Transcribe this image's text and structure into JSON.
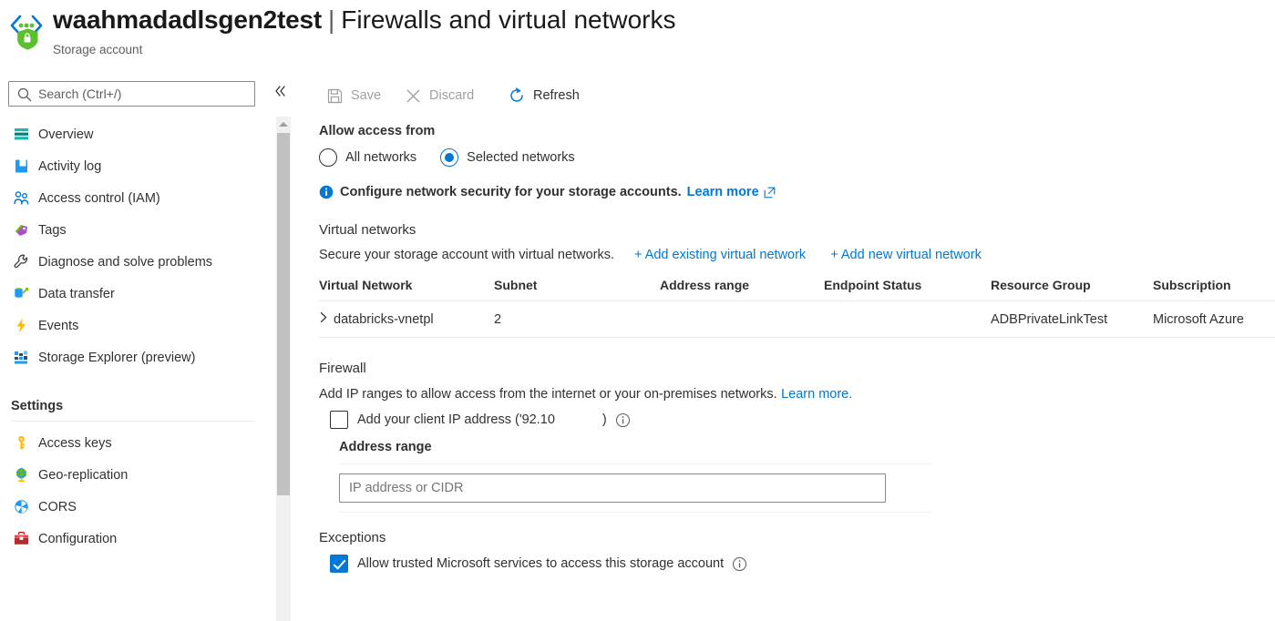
{
  "header": {
    "resource_name": "waahmadadlsgen2test",
    "separator": "|",
    "page_name": "Firewalls and virtual networks",
    "resource_type": "Storage account",
    "icon": "storage-account-icon"
  },
  "sidebar": {
    "search": {
      "placeholder": "Search (Ctrl+/)",
      "value": "",
      "icon": "search-icon"
    },
    "collapse_icon": "chevron-double-left-icon",
    "items": [
      {
        "label": "Overview",
        "icon": "overview-icon"
      },
      {
        "label": "Activity log",
        "icon": "activity-log-icon"
      },
      {
        "label": "Access control (IAM)",
        "icon": "access-control-icon"
      },
      {
        "label": "Tags",
        "icon": "tags-icon"
      },
      {
        "label": "Diagnose and solve problems",
        "icon": "wrench-icon"
      },
      {
        "label": "Data transfer",
        "icon": "data-transfer-icon"
      },
      {
        "label": "Events",
        "icon": "events-icon"
      },
      {
        "label": "Storage Explorer (preview)",
        "icon": "storage-explorer-icon"
      }
    ],
    "group_title": "Settings",
    "settings_items": [
      {
        "label": "Access keys",
        "icon": "key-icon"
      },
      {
        "label": "Geo-replication",
        "icon": "globe-icon"
      },
      {
        "label": "CORS",
        "icon": "cors-icon"
      },
      {
        "label": "Configuration",
        "icon": "toolbox-icon"
      }
    ]
  },
  "toolbar": {
    "save_label": "Save",
    "discard_label": "Discard",
    "refresh_label": "Refresh"
  },
  "main": {
    "allow_access_title": "Allow access from",
    "radio_all_networks": "All networks",
    "radio_selected_networks": "Selected networks",
    "selected_radio": "Selected networks",
    "info_banner_text": "Configure network security for your storage accounts.",
    "info_banner_link": "Learn more",
    "vnet_section_title": "Virtual networks",
    "vnet_section_desc": "Secure your storage account with virtual networks.",
    "add_existing_vnet": "+ Add existing virtual network",
    "add_new_vnet": "+ Add new virtual network",
    "vnet_table": {
      "columns": [
        "Virtual Network",
        "Subnet",
        "Address range",
        "Endpoint Status",
        "Resource Group",
        "Subscription"
      ],
      "rows": [
        {
          "virtual_network": "databricks-vnetpl",
          "subnet": "2",
          "address_range": "",
          "endpoint_status": "",
          "resource_group": "ADBPrivateLinkTest",
          "subscription": "Microsoft Azure"
        }
      ]
    },
    "firewall_title": "Firewall",
    "firewall_desc": "Add IP ranges to allow access from the internet or your on-premises networks.",
    "firewall_desc_link": "Learn more.",
    "client_ip_label": "Add your client IP address ('92.10",
    "client_ip_label_end": ")",
    "client_ip_checked": false,
    "address_range_label": "Address range",
    "address_range_value": "",
    "address_range_placeholder": "IP address or CIDR",
    "exceptions_title": "Exceptions",
    "trusted_services_label": "Allow trusted Microsoft services to access this storage account",
    "trusted_services_checked": true
  },
  "colors": {
    "accent": "#0078d4",
    "text": "#323130",
    "muted": "#605e5c",
    "disabled": "#a19f9d",
    "border": "#edebe9"
  }
}
